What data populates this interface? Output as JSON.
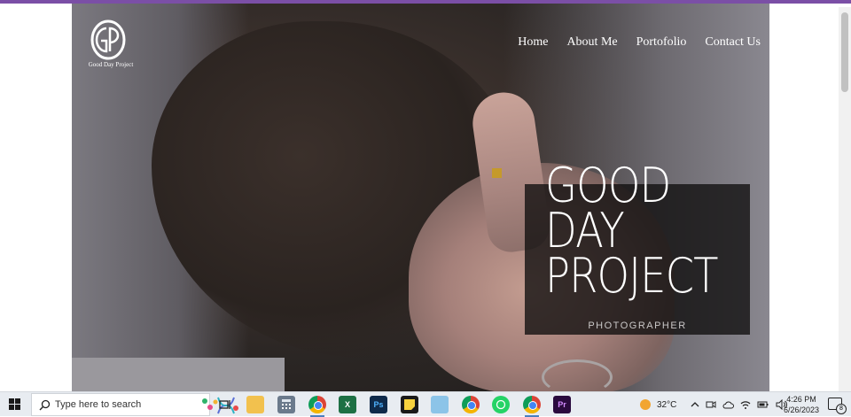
{
  "site": {
    "logo_text": "Good Day Project",
    "nav": [
      "Home",
      "About Me",
      "Portofolio",
      "Contact Us"
    ],
    "hero_title_lines": [
      "GOOD",
      "DAY",
      "PROJECT"
    ],
    "hero_subtitle": "PHOTOGRAPHER",
    "accent_color": "#c59a2b"
  },
  "taskbar": {
    "search_placeholder": "Type here to search",
    "weather": "32°C",
    "time": "4:26 PM",
    "date": "6/26/2023",
    "notification_count": "8"
  }
}
